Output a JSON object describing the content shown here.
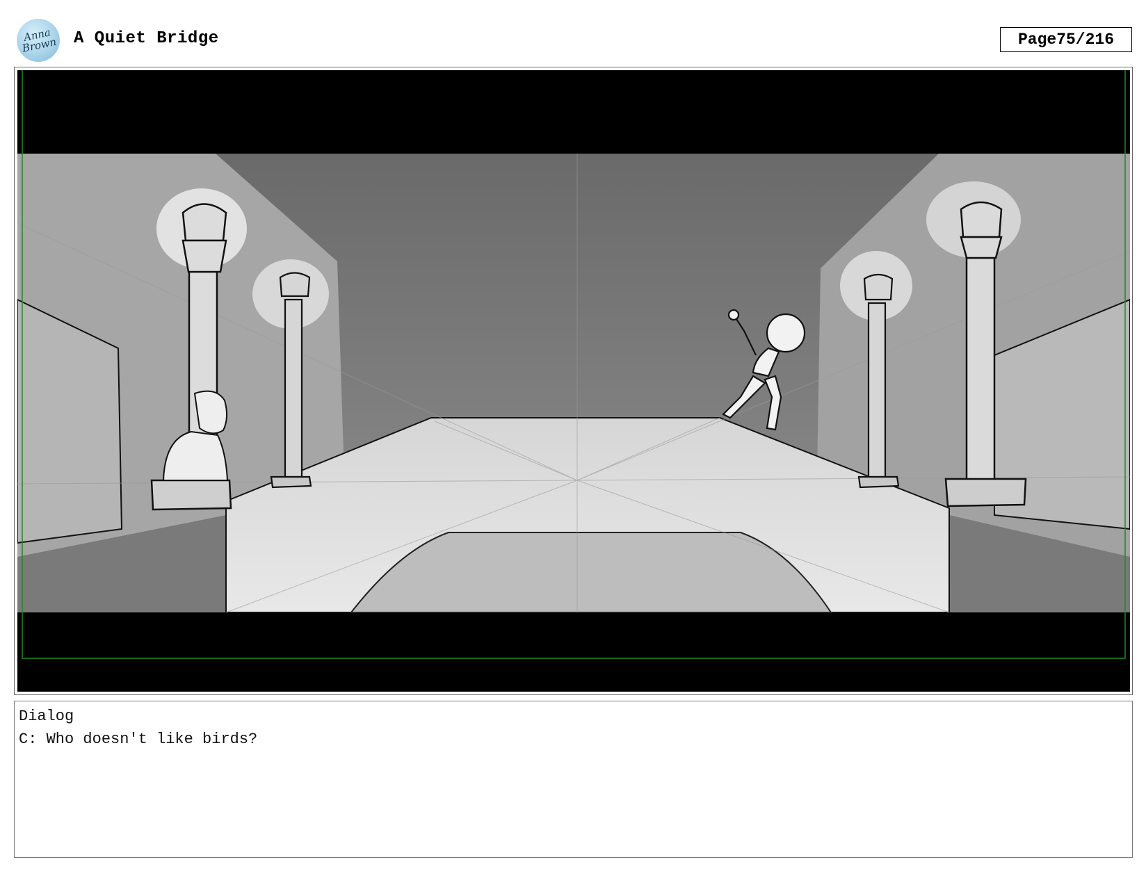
{
  "header": {
    "logo_text": "Anna Brown",
    "title": "A Quiet Bridge",
    "page_label": "Page",
    "page_number": "75/216"
  },
  "dialog": {
    "heading": "Dialog",
    "line": "C: Who doesn't like birds?"
  }
}
